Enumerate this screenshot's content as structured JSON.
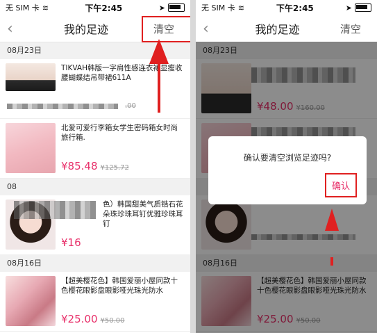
{
  "status": {
    "carrier": "无 SIM 卡",
    "time": "下午2:45"
  },
  "nav": {
    "back": "‹",
    "title": "我的足迹",
    "clear": "清空"
  },
  "groups": [
    {
      "date": "08月23日",
      "items": [
        {
          "name": "TIKVAH韩版一字肩性感连衣裙显瘦收腰蝴蝶结吊带裙611A",
          "price": "",
          "old_price": ".00"
        },
        {
          "name": "北爱可爱行李箱女学生密码箱女时尚旅行箱.",
          "price": "¥85.48",
          "old_price": "¥125.72"
        }
      ]
    },
    {
      "date": "08",
      "items": [
        {
          "name": "色）韩国甜美气质锆石花朵珠珍珠耳钉优雅珍珠耳钉",
          "price": "¥16",
          "old_price": ""
        }
      ]
    },
    {
      "date": "08月16日",
      "items": [
        {
          "name": "【超美樱花色】韩国爱丽小屋同款十色樱花眼影盘眼影哑光珠光防水",
          "price": "¥25.00",
          "old_price": "¥50.00"
        }
      ]
    }
  ],
  "right": {
    "groups": [
      {
        "date": "08月23日",
        "price": "¥48.00",
        "old_price": "¥160.00"
      },
      {
        "date": "08月16日",
        "name": "【超美樱花色】韩国爱丽小屋同款十色樱花眼影盘眼影哑光珠光防水",
        "price": "¥25.00",
        "old_price": "¥50.00"
      }
    ],
    "dialog": {
      "message": "确认要清空浏览足迹吗?",
      "confirm": "确认"
    }
  },
  "colors": {
    "accent": "#e8306a",
    "annotation": "#e02020"
  }
}
